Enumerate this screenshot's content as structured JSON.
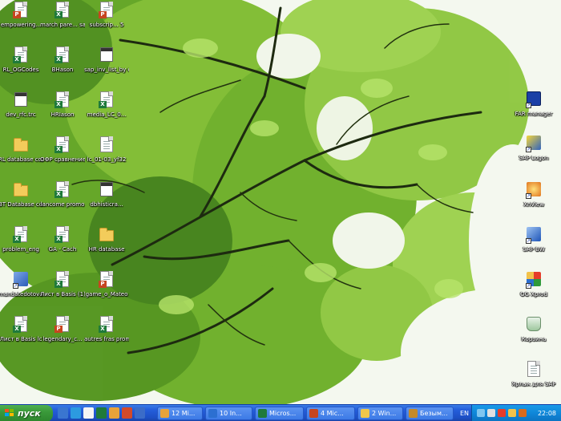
{
  "desktop": {
    "left_icons": [
      {
        "label": "empowering...",
        "kind": "ppt"
      },
      {
        "label": "march pare... sauce",
        "kind": "excel"
      },
      {
        "label": "subscrip... 5",
        "kind": "ppt"
      },
      {
        "label": "RL_OGCodes",
        "kind": "excel"
      },
      {
        "label": "BHason",
        "kind": "excel"
      },
      {
        "label": "sap_inv_list_by class of inv",
        "kind": "cal"
      },
      {
        "label": "dev_rfc.trc",
        "kind": "cal"
      },
      {
        "label": "HRIason",
        "kind": "excel"
      },
      {
        "label": "media_LC_0...",
        "kind": "excel"
      },
      {
        "label": "RL database correction",
        "kind": "folder"
      },
      {
        "label": "ОФР сравнение",
        "kind": "excel"
      },
      {
        "label": "lc_01-03_yf32",
        "kind": "doc"
      },
      {
        "label": "BT Database correction",
        "kind": "folder"
      },
      {
        "label": "lancome promo",
        "kind": "excel"
      },
      {
        "label": "dbhisticra...",
        "kind": "cal"
      },
      {
        "label": "problem_eng",
        "kind": "excel"
      },
      {
        "label": "GA - Cach",
        "kind": "excel"
      },
      {
        "label": "HR database",
        "kind": "folder"
      },
      {
        "label": "mandatedotova on RL/CRP...",
        "kind": "app"
      },
      {
        "label": "Лист в Basis (1)",
        "kind": "excel"
      },
      {
        "label": "game_o_Mateo",
        "kind": "ppt"
      },
      {
        "label": "Лист в Basis lc",
        "kind": "excel"
      },
      {
        "label": "legendary_c...",
        "kind": "ppt"
      },
      {
        "label": "autres fras promo 02",
        "kind": "excel"
      }
    ],
    "right_icons": [
      {
        "label": "FAR manager",
        "kind": "far"
      },
      {
        "label": "SAP Logon",
        "kind": "sap"
      },
      {
        "label": "XnView",
        "kind": "xnview"
      },
      {
        "label": "SAP BW",
        "kind": "sapbw"
      },
      {
        "label": "OG Xprod",
        "kind": "cube"
      },
      {
        "label": "Корзина",
        "kind": "bin"
      },
      {
        "label": "Ярлык для SAP",
        "kind": "doc"
      }
    ]
  },
  "taskbar": {
    "start_label": "пуск",
    "tasks": [
      {
        "label": "12 Mi...",
        "color": "#e8a33a"
      },
      {
        "label": "10 In...",
        "color": "#2c6fd1"
      },
      {
        "label": "Micros...",
        "color": "#1f7a3a"
      },
      {
        "label": "4 Mic...",
        "color": "#c7451f"
      },
      {
        "label": "2 Win...",
        "color": "#f0c74a"
      },
      {
        "label": "Безым...",
        "color": "#c48a2a"
      }
    ],
    "language": "EN",
    "clock": "22:08"
  },
  "colors": {
    "taskbar": "#245edb",
    "start": "#3a9a3a",
    "leaf_dark": "#2f6e10",
    "leaf_mid": "#5fa31f",
    "leaf_light": "#9bd14a"
  }
}
